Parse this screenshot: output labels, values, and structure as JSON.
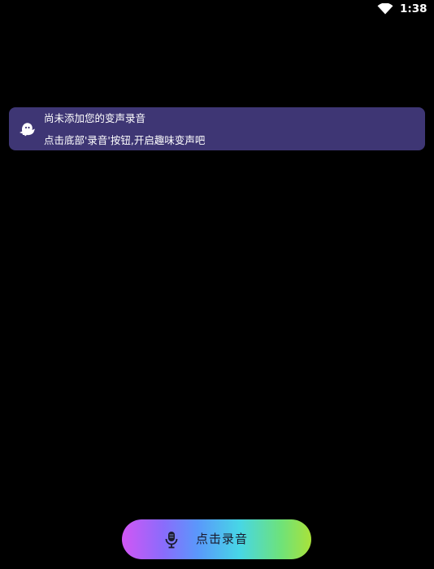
{
  "status_bar": {
    "time": "1:38",
    "wifi_icon": "wifi-icon"
  },
  "empty_state": {
    "icon": "ghost-icon",
    "line1": "尚未添加您的变声录音",
    "line2": "点击底部'录音'按钮,开启趣味变声吧",
    "background": "#3e3674"
  },
  "record_button": {
    "label": "点击录音",
    "icon": "microphone-icon",
    "gradient_colors": [
      "#d256f5",
      "#8a6cfb",
      "#5a98fb",
      "#47d6e6",
      "#6ee27a",
      "#a9e23a"
    ]
  }
}
